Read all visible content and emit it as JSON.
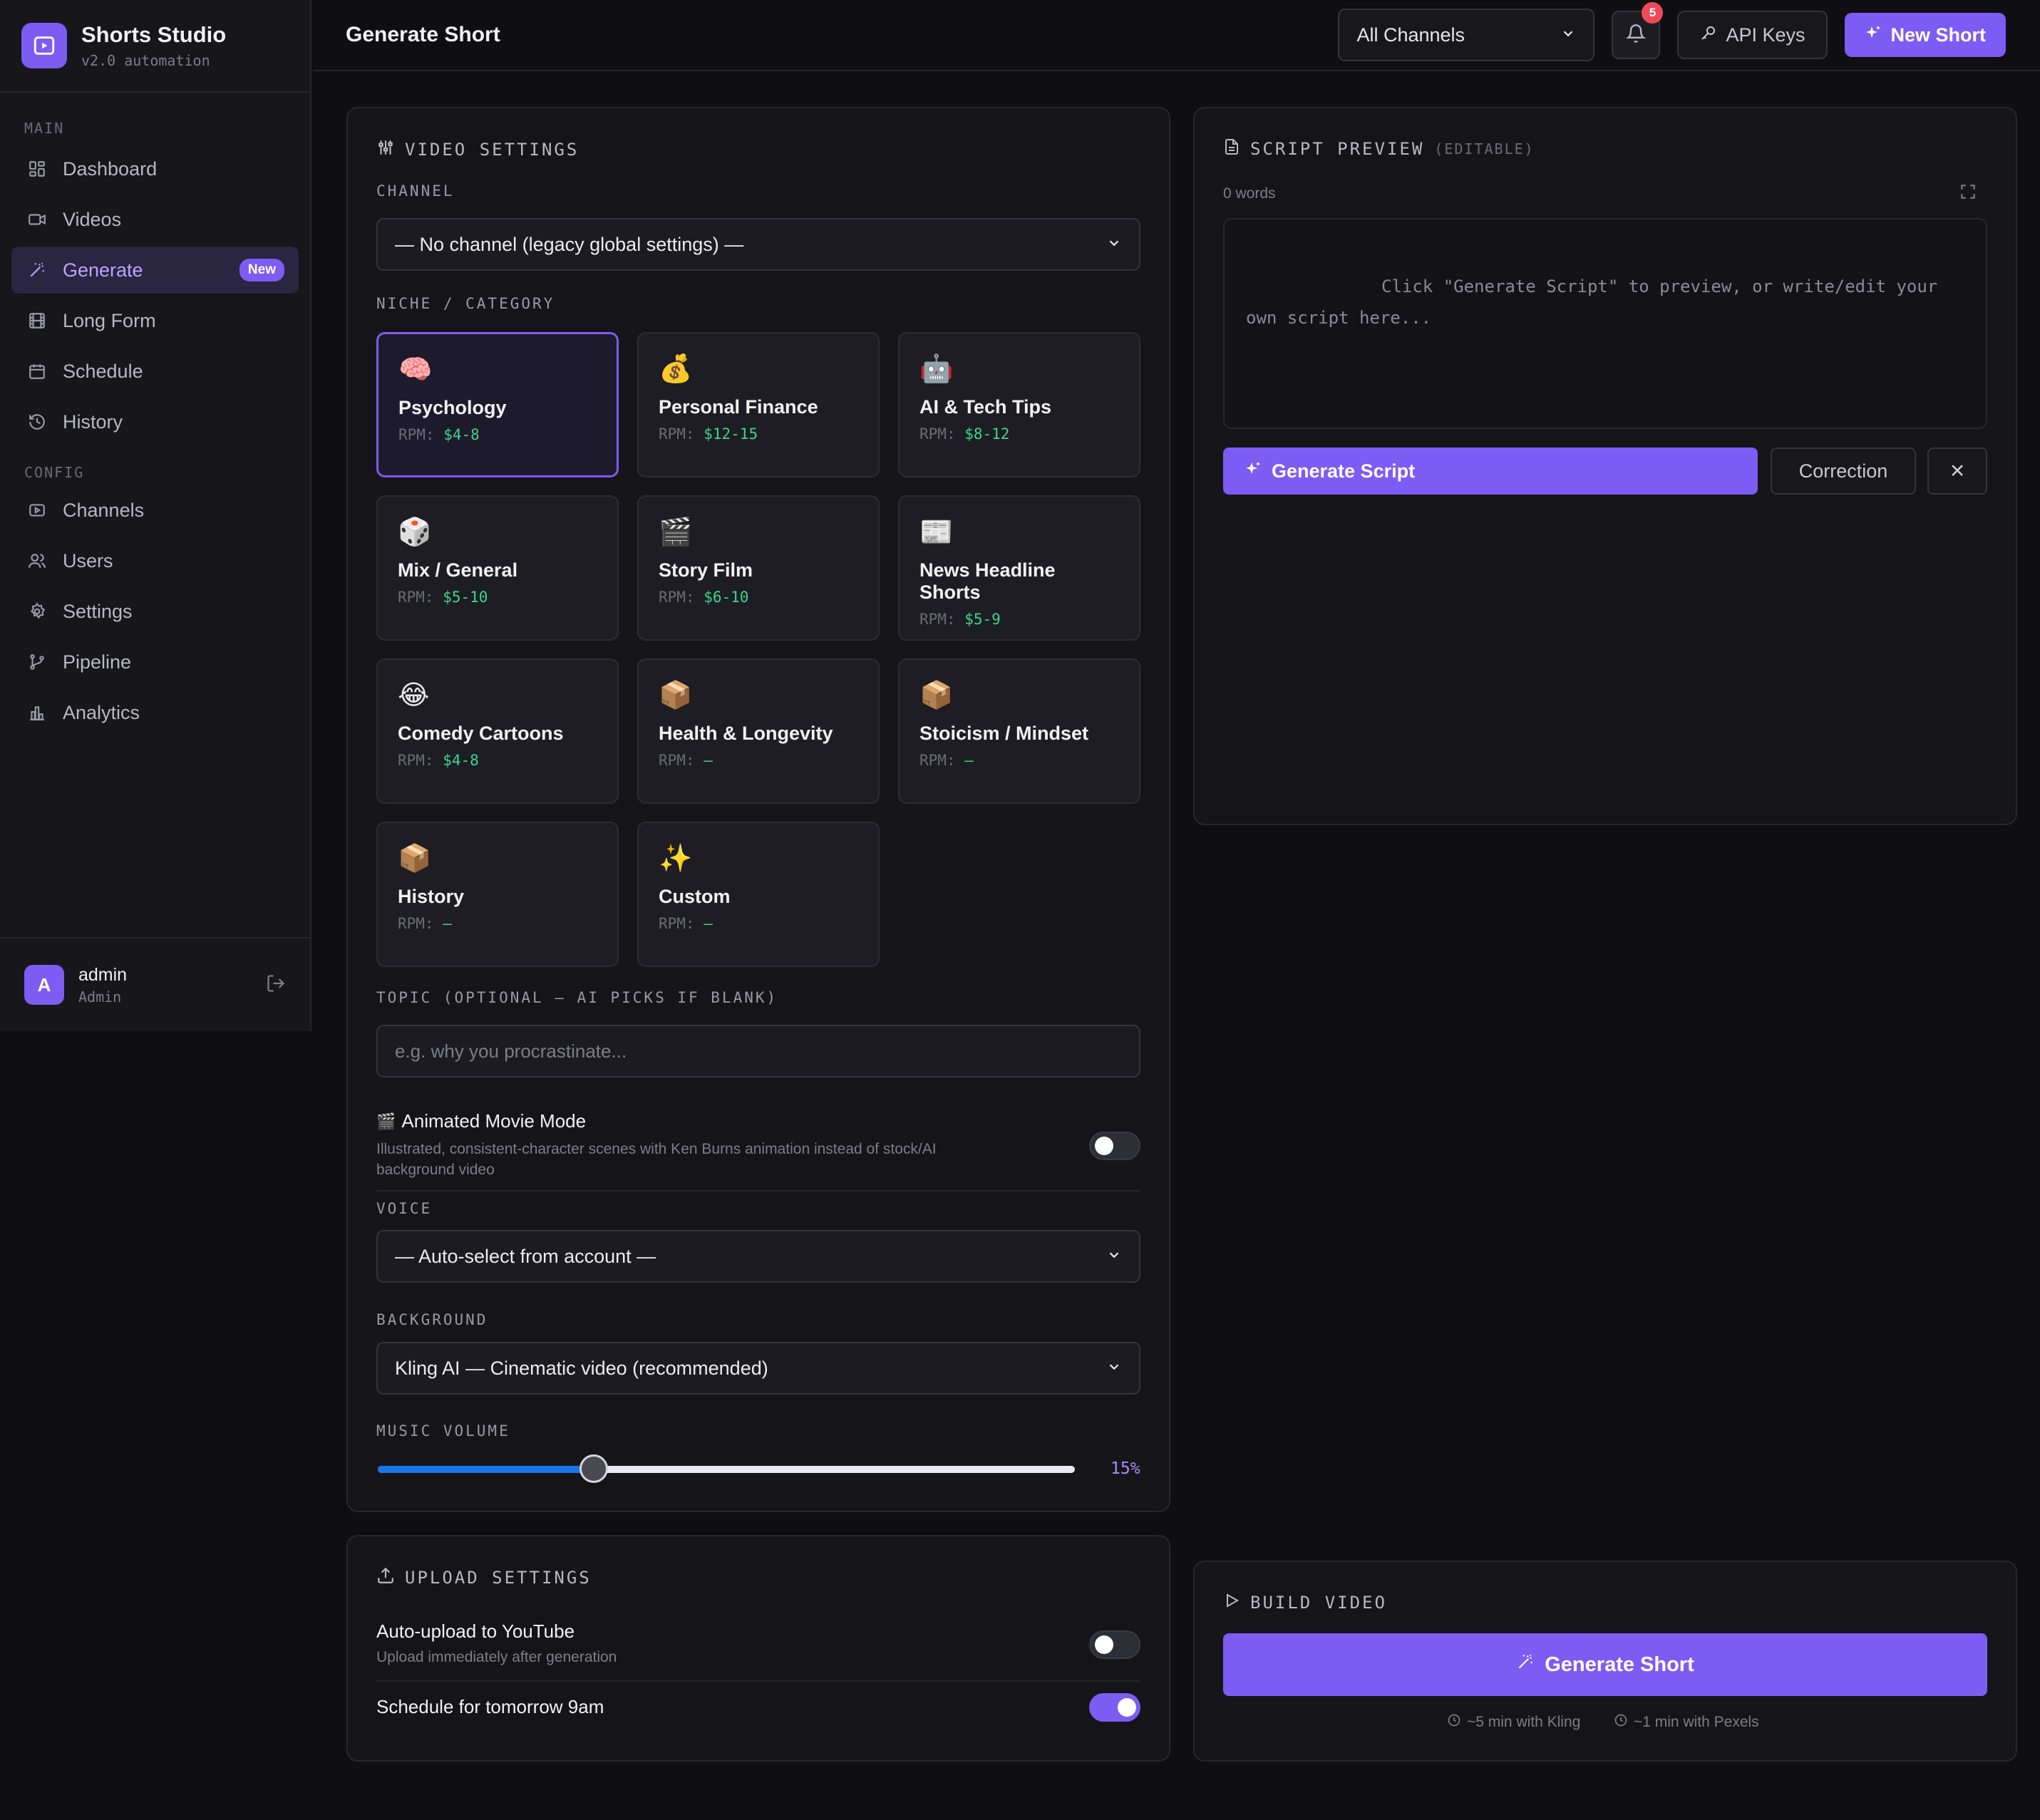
{
  "app": {
    "name": "Shorts Studio",
    "version": "v2.0 automation"
  },
  "sidebar": {
    "sections": [
      {
        "label": "MAIN",
        "items": [
          {
            "label": "Dashboard",
            "icon": "grid-icon"
          },
          {
            "label": "Videos",
            "icon": "video-icon"
          },
          {
            "label": "Generate",
            "icon": "wand-icon",
            "badge": "New",
            "active": true
          },
          {
            "label": "Long Form",
            "icon": "film-icon"
          },
          {
            "label": "Schedule",
            "icon": "calendar-icon"
          },
          {
            "label": "History",
            "icon": "history-icon"
          }
        ]
      },
      {
        "label": "CONFIG",
        "items": [
          {
            "label": "Channels",
            "icon": "play-square-icon"
          },
          {
            "label": "Users",
            "icon": "users-icon"
          },
          {
            "label": "Settings",
            "icon": "gear-icon"
          },
          {
            "label": "Pipeline",
            "icon": "branch-icon"
          },
          {
            "label": "Analytics",
            "icon": "bar-chart-icon"
          }
        ]
      }
    ],
    "user": {
      "initial": "A",
      "name": "admin",
      "role": "Admin"
    }
  },
  "header": {
    "title": "Generate Short",
    "channel_filter": "All Channels",
    "notifications_count": "5",
    "api_keys_label": "API Keys",
    "new_short_label": "New Short"
  },
  "video_settings": {
    "title": "VIDEO SETTINGS",
    "channel_label": "CHANNEL",
    "channel_value": "— No channel (legacy global settings) —",
    "niche_label": "NICHE / CATEGORY",
    "niches": [
      {
        "emoji": "🧠",
        "name": "Psychology",
        "rpm_prefix": "RPM:",
        "rpm": "$4-8",
        "selected": true
      },
      {
        "emoji": "💰",
        "name": "Personal Finance",
        "rpm_prefix": "RPM:",
        "rpm": "$12-15"
      },
      {
        "emoji": "🤖",
        "name": "AI & Tech Tips",
        "rpm_prefix": "RPM:",
        "rpm": "$8-12"
      },
      {
        "emoji": "🎲",
        "name": "Mix / General",
        "rpm_prefix": "RPM:",
        "rpm": "$5-10"
      },
      {
        "emoji": "🎬",
        "name": "Story Film",
        "rpm_prefix": "RPM:",
        "rpm": "$6-10"
      },
      {
        "emoji": "📰",
        "name": "News Headline Shorts",
        "rpm_prefix": "RPM:",
        "rpm": "$5-9"
      },
      {
        "emoji": "😂",
        "name": "Comedy Cartoons",
        "rpm_prefix": "RPM:",
        "rpm": "$4-8"
      },
      {
        "emoji": "📦",
        "name": "Health & Longevity",
        "rpm_prefix": "RPM:",
        "rpm": "—"
      },
      {
        "emoji": "📦",
        "name": "Stoicism / Mindset",
        "rpm_prefix": "RPM:",
        "rpm": "—"
      },
      {
        "emoji": "📦",
        "name": "History",
        "rpm_prefix": "RPM:",
        "rpm": "—"
      },
      {
        "emoji": "✨",
        "name": "Custom",
        "rpm_prefix": "RPM:",
        "rpm": "—"
      }
    ],
    "topic_label": "TOPIC (OPTIONAL — AI PICKS IF BLANK)",
    "topic_placeholder": "e.g. why you procrastinate...",
    "animated_mode": {
      "emoji": "🎬",
      "title": "Animated Movie Mode",
      "description_line1": "Illustrated, consistent-character scenes with Ken Burns animation instead of stock/AI",
      "description_line2": "background video",
      "enabled": false
    },
    "voice_label": "VOICE",
    "voice_value": "— Auto-select from account —",
    "background_label": "BACKGROUND",
    "background_value": "Kling AI — Cinematic video (recommended)",
    "music_volume_label": "MUSIC VOLUME",
    "music_volume_display": "15%",
    "music_volume_fraction": 0.31
  },
  "upload_settings": {
    "title": "UPLOAD SETTINGS",
    "auto_upload_title": "Auto-upload to YouTube",
    "auto_upload_desc": "Upload immediately after generation",
    "auto_upload_enabled": false,
    "schedule_title": "Schedule for tomorrow 9am",
    "schedule_enabled": true
  },
  "script_preview": {
    "title": "SCRIPT PREVIEW",
    "subtitle": "(EDITABLE)",
    "word_count": "0 words",
    "placeholder": "Click \"Generate Script\" to preview, or write/edit your own script here...",
    "generate_label": "Generate Script",
    "correction_label": "Correction",
    "close_symbol": "✕"
  },
  "build_video": {
    "title": "BUILD VIDEO",
    "button_label": "Generate Short",
    "hint_kling": "~5 min with Kling",
    "hint_pexels": "~1 min with Pexels"
  },
  "colors": {
    "accent": "#7c5cf2",
    "rpm_green": "#3dd68c",
    "notification_red": "#ef4a5a",
    "slider_blue": "#1a73e8"
  }
}
